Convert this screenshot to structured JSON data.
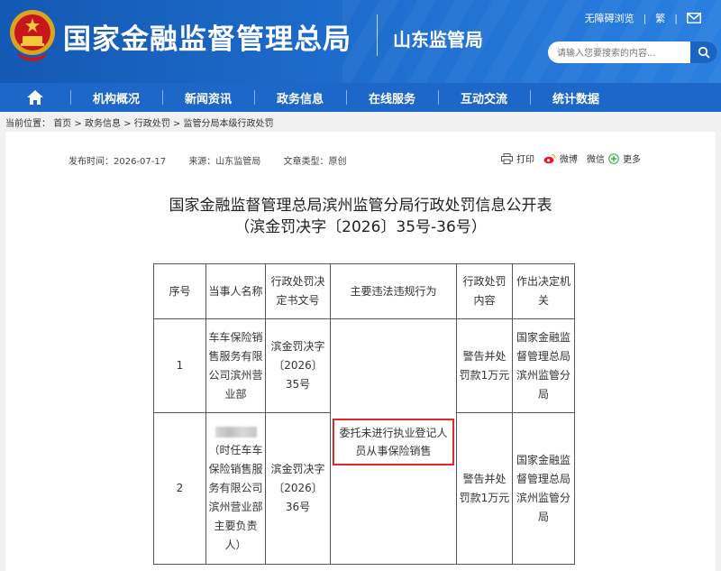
{
  "header": {
    "site_title": "国家金融监督管理总局",
    "branch_name": "山东监管局",
    "accessibility_link": "无障碍浏览",
    "traditional_link": "繁",
    "search_placeholder": "请输入您要搜索的内容...",
    "brand_color": "#1d67c8"
  },
  "nav": {
    "items": [
      "机构概况",
      "新闻资讯",
      "政务信息",
      "在线服务",
      "互动交流",
      "统计数据"
    ]
  },
  "breadcrumb": {
    "prefix": "当前位置：",
    "items": [
      "首页",
      "政务信息",
      "行政处罚",
      "监管分局本级行政处罚"
    ],
    "separator": ">"
  },
  "article": {
    "publish_time": "发布时间：2026-07-17",
    "source": "来源：山东监管局",
    "doc_type": "文章类型：原创",
    "share": {
      "print": "打印",
      "weibo": "微博",
      "wechat": "微信",
      "more": "更多"
    },
    "title_line1": "国家金融监督管理总局滨州监管分局行政处罚信息公开表",
    "title_line2": "（滨金罚决字〔2026〕35号-36号）"
  },
  "table": {
    "headers": [
      "序号",
      "当事人名称",
      "行政处罚决定书文号",
      "主要违法违规行为",
      "行政处罚内容",
      "作出决定机关"
    ],
    "violation": "委托未进行执业登记人员从事保险销售",
    "rows": [
      {
        "index": "1",
        "party": "车车保险销售服务有限公司滨州营业部",
        "doc_no": "滨金罚决字〔2026〕35号",
        "penalty": "警告并处罚款1万元",
        "authority": "国家金融监督管理总局滨州监管分局"
      },
      {
        "index": "2",
        "party": "（时任车车保险销售服务有限公司滨州营业部主要负责人）",
        "doc_no": "滨金罚决字〔2026〕36号",
        "penalty": "警告并处罚款1万元",
        "authority": "国家金融监督管理总局滨州监管分局"
      }
    ]
  },
  "icons": [
    "national-emblem-icon",
    "mail-icon",
    "search-icon",
    "home-icon",
    "print-icon",
    "weibo-icon",
    "wechat-icon",
    "more-icon"
  ]
}
